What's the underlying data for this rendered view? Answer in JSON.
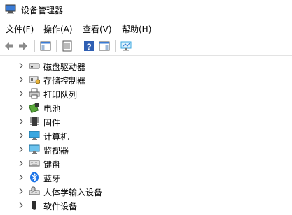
{
  "window": {
    "title": "设备管理器",
    "app_icon": "device-manager-icon"
  },
  "menu": {
    "items": [
      "文件(F)",
      "操作(A)",
      "查看(V)",
      "帮助(H)"
    ]
  },
  "toolbar": {
    "buttons": [
      "back-icon",
      "forward-icon",
      "show-hide-console-tree-icon",
      "properties-icon",
      "help-icon",
      "action-pane-icon",
      "monitor-icon"
    ]
  },
  "tree": {
    "items": [
      {
        "label": "磁盘驱动器",
        "icon": "disk-drive-icon"
      },
      {
        "label": "存储控制器",
        "icon": "storage-controller-icon"
      },
      {
        "label": "打印队列",
        "icon": "printer-icon"
      },
      {
        "label": "电池",
        "icon": "battery-icon"
      },
      {
        "label": "固件",
        "icon": "firmware-icon"
      },
      {
        "label": "计算机",
        "icon": "computer-icon"
      },
      {
        "label": "监视器",
        "icon": "monitor-icon"
      },
      {
        "label": "键盘",
        "icon": "keyboard-icon"
      },
      {
        "label": "蓝牙",
        "icon": "bluetooth-icon"
      },
      {
        "label": "人体学输入设备",
        "icon": "hid-icon"
      },
      {
        "label": "软件设备",
        "icon": "software-device-icon"
      }
    ]
  },
  "colors": {
    "accent_blue": "#2b7bd1",
    "help_blue": "#2f5fb3",
    "bluetooth_blue": "#1a73e8",
    "monitor_cyan": "#3aa7e0"
  }
}
